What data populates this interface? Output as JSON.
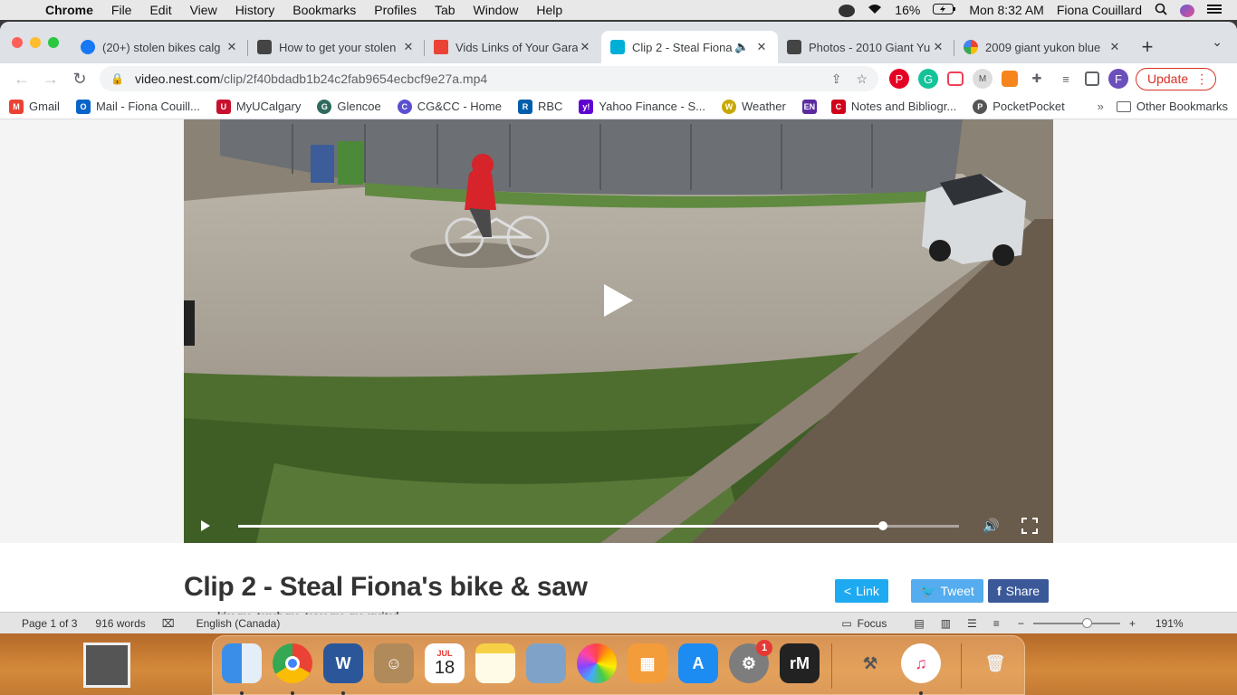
{
  "menubar": {
    "app": "Chrome",
    "items": [
      "File",
      "Edit",
      "View",
      "History",
      "Bookmarks",
      "Profiles",
      "Tab",
      "Window",
      "Help"
    ],
    "battery": "16%",
    "clock": "Mon 8:32 AM",
    "user": "Fiona Couillard"
  },
  "tabs": [
    {
      "title": "(20+) stolen bikes calg",
      "favicon_color": "#1877f2"
    },
    {
      "title": "How to get your stolen",
      "favicon_color": "#444444"
    },
    {
      "title": "Vids Links of Your Gara",
      "favicon_color": "#ea4335"
    },
    {
      "title": "Clip 2 - Steal Fiona",
      "favicon_color": "#00afd8",
      "active": true
    },
    {
      "title": "Photos - 2010 Giant Yu",
      "favicon_color": "#444444"
    },
    {
      "title": "2009 giant yukon blue",
      "favicon_color": "#4285f4"
    }
  ],
  "address": {
    "host": "video.nest.com",
    "path": "/clip/2f40bdadb1b24c2fab9654ecbcf9e27a.mp4"
  },
  "update_label": "Update",
  "profile_initial": "F",
  "bookmarks": [
    {
      "label": "Gmail",
      "color": "#ea4335",
      "glyph": "M"
    },
    {
      "label": "Mail - Fiona Couill...",
      "color": "#0a64c8",
      "glyph": "O"
    },
    {
      "label": "MyUCalgary",
      "color": "#c8102e",
      "glyph": "U"
    },
    {
      "label": "Glencoe",
      "color": "#2e6b5e",
      "glyph": "G"
    },
    {
      "label": "CG&CC - Home",
      "color": "#5a4fcf",
      "glyph": "C"
    },
    {
      "label": "RBC",
      "color": "#005daa",
      "glyph": "R"
    },
    {
      "label": "Yahoo Finance - S...",
      "color": "#6001d2",
      "glyph": "y!"
    },
    {
      "label": "Weather",
      "color": "#c8a800",
      "glyph": "W"
    },
    {
      "label": "",
      "color": "#5b2ca0",
      "glyph": "EN"
    },
    {
      "label": "Notes and Bibliogr...",
      "color": "#d0021b",
      "glyph": "C"
    },
    {
      "label": "PocketPocket",
      "color": "#555555",
      "glyph": "P"
    }
  ],
  "bookmarks_more": "»",
  "other_bookmarks": "Other Bookmarks",
  "video": {
    "progress": 0.895
  },
  "page": {
    "title": "Clip 2 - Steal Fiona's bike & saw",
    "link_label": "Link",
    "tweet_label": "Tweet",
    "share_label": "Share"
  },
  "word": {
    "page": "Page 1 of 3",
    "words": "916 words",
    "language": "English (Canada)",
    "focus": "Focus",
    "zoom": "191%",
    "background_text": "kiss me, touch me, tease me, me excited"
  },
  "dock": {
    "calendar_month": "JUL",
    "calendar_day": "18",
    "settings_badge": "1",
    "rm_label": "rM"
  }
}
